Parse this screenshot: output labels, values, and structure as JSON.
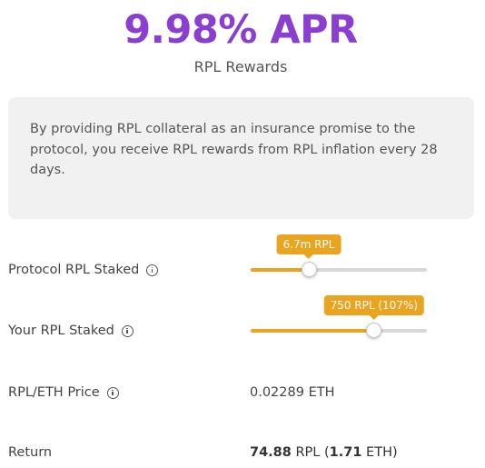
{
  "header": {
    "apr": "9.98% APR",
    "subtitle": "RPL Rewards"
  },
  "info": {
    "text": "By providing RPL collateral as an insurance promise to the protocol, you receive RPL rewards from RPL inflation every 28 days."
  },
  "protocol_staked": {
    "label": "Protocol RPL Staked",
    "icon": "info-circle-icon",
    "tooltip": "6.7m RPL",
    "slider_fraction": 0.33
  },
  "your_staked": {
    "label": "Your RPL Staked",
    "icon": "info-circle-icon",
    "tooltip": "750 RPL (107%)",
    "slider_fraction": 0.7
  },
  "price": {
    "label": "RPL/ETH Price",
    "icon": "info-circle-icon",
    "value": "0.02289 ETH"
  },
  "return": {
    "label": "Return",
    "rpl_amount": "74.88",
    "rpl_unit": " RPL (",
    "eth_amount": "1.71",
    "eth_unit": " ETH)"
  },
  "colors": {
    "accent_purple": "#8b3fd1",
    "slider_orange": "#eba41f",
    "panel_gray": "#f1f1f2"
  }
}
